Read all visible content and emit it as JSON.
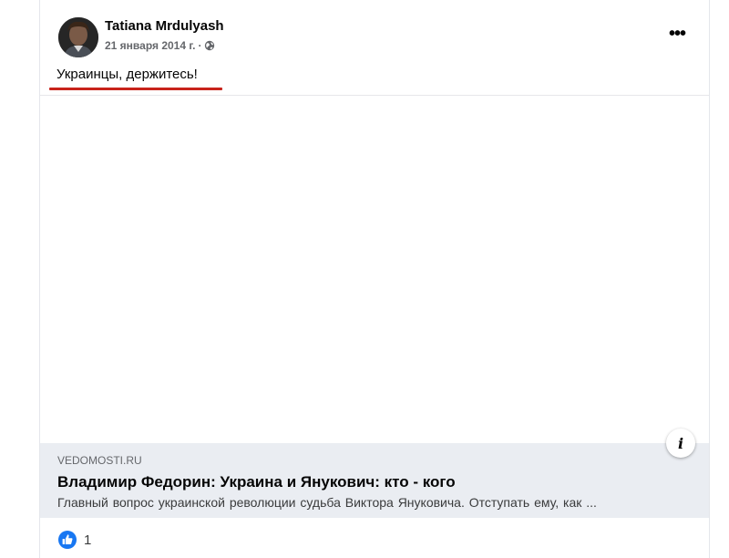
{
  "post": {
    "author": "Tatiana Mrdulyash",
    "date": "21 января 2014 г.",
    "meta_separator": "·",
    "audience_icon": "globe-icon",
    "more_icon": "more-horizontal-icon",
    "more_label": "•••",
    "text": "Украинцы, держитесь!"
  },
  "link_preview": {
    "domain": "VEDOMOSTI.RU",
    "title": "Владимир Федорин: Украина и Янукович: кто - кого",
    "description": "Главный вопрос украинской революции    судьба Виктора Януковича. Отступать ему, как ...",
    "info_label": "i",
    "info_icon": "info-icon"
  },
  "reactions": {
    "icon": "like-icon",
    "count": "1"
  },
  "colors": {
    "underline": "#c8231b",
    "like_blue": "#1877f2",
    "preview_bg": "#eaedf2"
  }
}
